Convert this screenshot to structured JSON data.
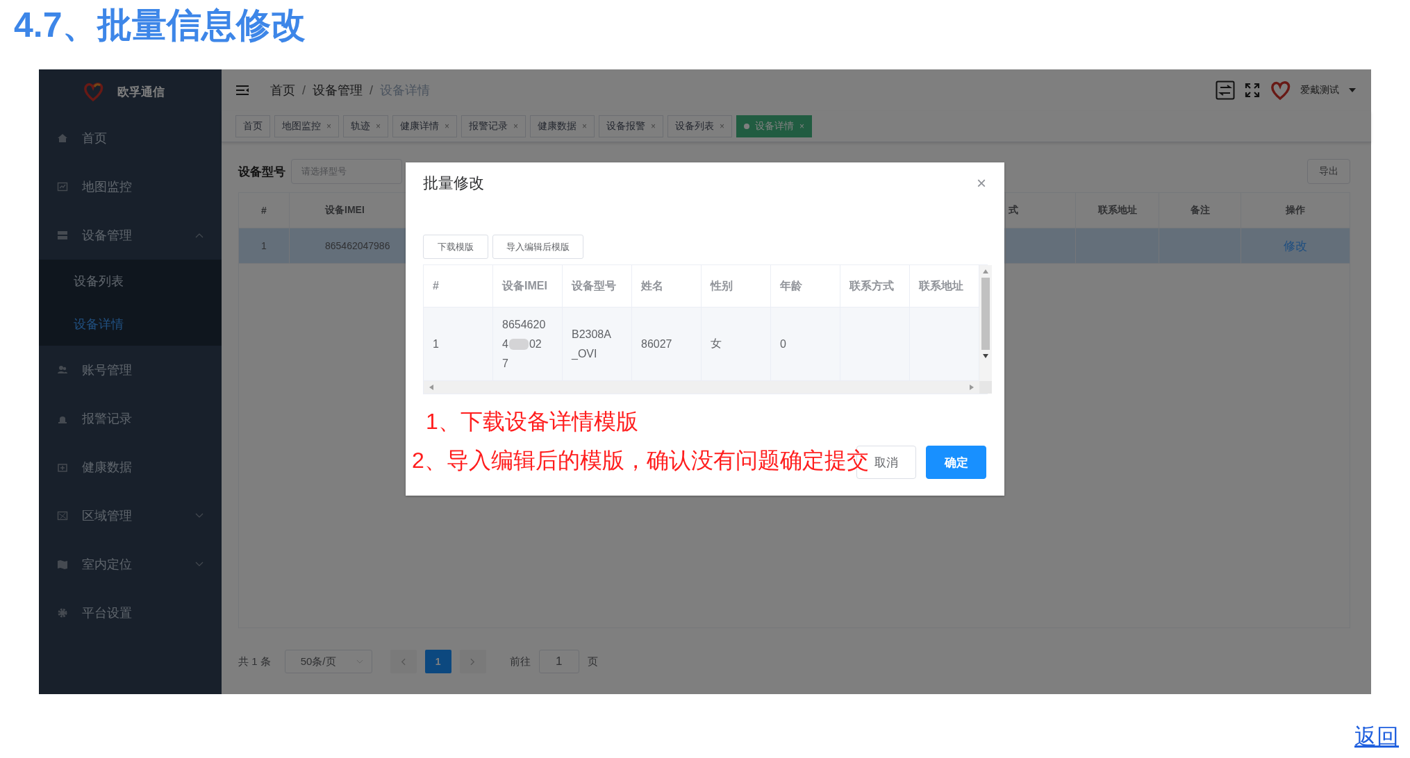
{
  "doc_title": "4.7、批量信息修改",
  "app": {
    "brand": "欧孚通信",
    "sidebar": [
      {
        "label": "首页",
        "selected": false
      },
      {
        "label": "地图监控",
        "selected": false
      },
      {
        "label": "设备管理",
        "expanded": true,
        "selected": false,
        "children": [
          {
            "label": "设备列表",
            "selected": false
          },
          {
            "label": "设备详情",
            "selected": true
          }
        ]
      },
      {
        "label": "账号管理",
        "selected": false
      },
      {
        "label": "报警记录",
        "selected": false
      },
      {
        "label": "健康数据",
        "selected": false
      },
      {
        "label": "区域管理",
        "expanded": false,
        "selected": false
      },
      {
        "label": "室内定位",
        "expanded": false,
        "selected": false
      },
      {
        "label": "平台设置",
        "selected": false
      }
    ],
    "breadcrumb": [
      "首页",
      "设备管理",
      "设备详情"
    ],
    "breadcrumb_separator": "/",
    "user": "爱戴测试",
    "close_glyph": "×",
    "tabs": [
      {
        "label": "首页",
        "closable": false,
        "selected": false
      },
      {
        "label": "地图监控",
        "closable": true,
        "selected": false
      },
      {
        "label": "轨迹",
        "closable": true,
        "selected": false
      },
      {
        "label": "健康详情",
        "closable": true,
        "selected": false
      },
      {
        "label": "报警记录",
        "closable": true,
        "selected": false
      },
      {
        "label": "健康数据",
        "closable": true,
        "selected": false
      },
      {
        "label": "设备报警",
        "closable": true,
        "selected": false
      },
      {
        "label": "设备列表",
        "closable": true,
        "selected": false
      },
      {
        "label": "设备详情",
        "closable": true,
        "selected": true
      }
    ],
    "filter": {
      "label": "设备型号",
      "placeholder": "请选择型号",
      "export": "导出"
    },
    "table": {
      "columns": [
        "#",
        "设备IMEI",
        "式",
        "联系地址",
        "备注",
        "操作"
      ],
      "rows": [
        {
          "index": "1",
          "imei": "865462047986",
          "action": "修改",
          "selected": true
        }
      ]
    },
    "pagination": {
      "total": "共 1 条",
      "page_size": "50条/页",
      "pages": [
        {
          "label": "1",
          "selected": true
        }
      ],
      "goto_label": "前往",
      "goto_value": "1",
      "page_unit": "页"
    }
  },
  "dialog": {
    "title": "批量修改",
    "close": "×",
    "buttons": [
      "下载模版",
      "导入编辑后模版"
    ],
    "columns": [
      "#",
      "设备IMEI",
      "设备型号",
      "姓名",
      "性别",
      "年龄",
      "联系方式",
      "联系地址"
    ],
    "rows": [
      {
        "index": "1",
        "imei_parts": [
          "8654620",
          "4",
          "02",
          "7"
        ],
        "model": "B2308A_OVI",
        "name": "86027",
        "gender": "女",
        "age": "0"
      }
    ],
    "cancel": "取消",
    "confirm": "确定"
  },
  "annotations": [
    "1、下载设备详情模版",
    "2、导入编辑后的模版，确认没有问题确定提交"
  ],
  "back_link": "返回"
}
